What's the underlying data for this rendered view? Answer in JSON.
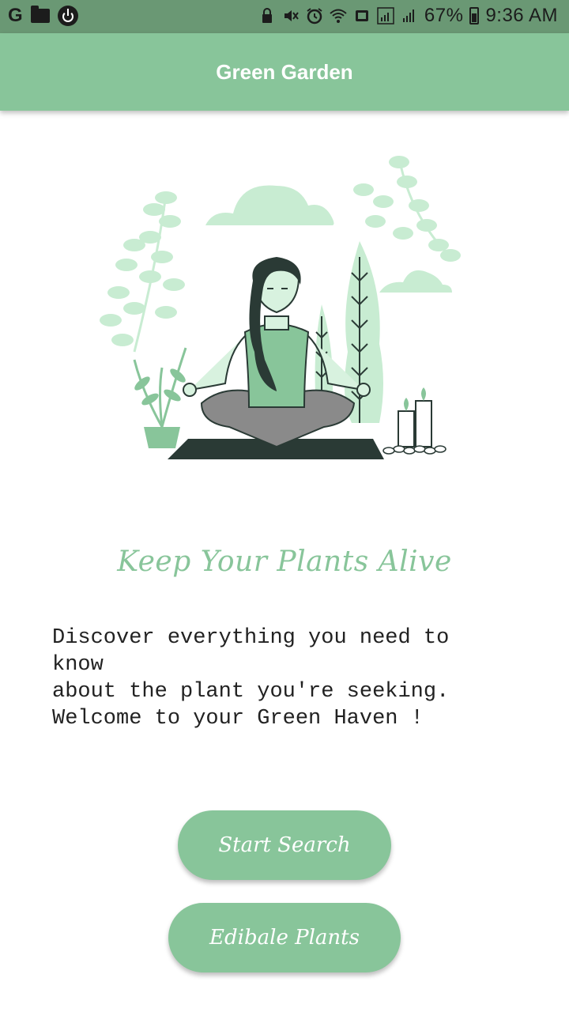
{
  "status_bar": {
    "left_icons": [
      "google-icon",
      "folder-icon",
      "power-icon"
    ],
    "google_glyph": "G",
    "battery_percent": "67%",
    "time": "9:36 AM",
    "right_icons": [
      "lock-icon",
      "mute-icon",
      "alarm-icon",
      "wifi-icon",
      "cast-icon",
      "signal-icon",
      "signal-icon",
      "battery-icon"
    ]
  },
  "app_bar": {
    "title": "Green Garden"
  },
  "tagline": "Keep Your Plants Alive",
  "description": "Discover everything you need to know\nabout the plant you're seeking.\nWelcome to your Green Haven !",
  "buttons": {
    "start_search": "Start Search",
    "edible_plants": "Edibale Plants"
  },
  "colors": {
    "app_bar": "#88c59a",
    "status_bar": "#6a9874",
    "accent": "#88c59a",
    "leaf_light": "#c8ecd2"
  }
}
